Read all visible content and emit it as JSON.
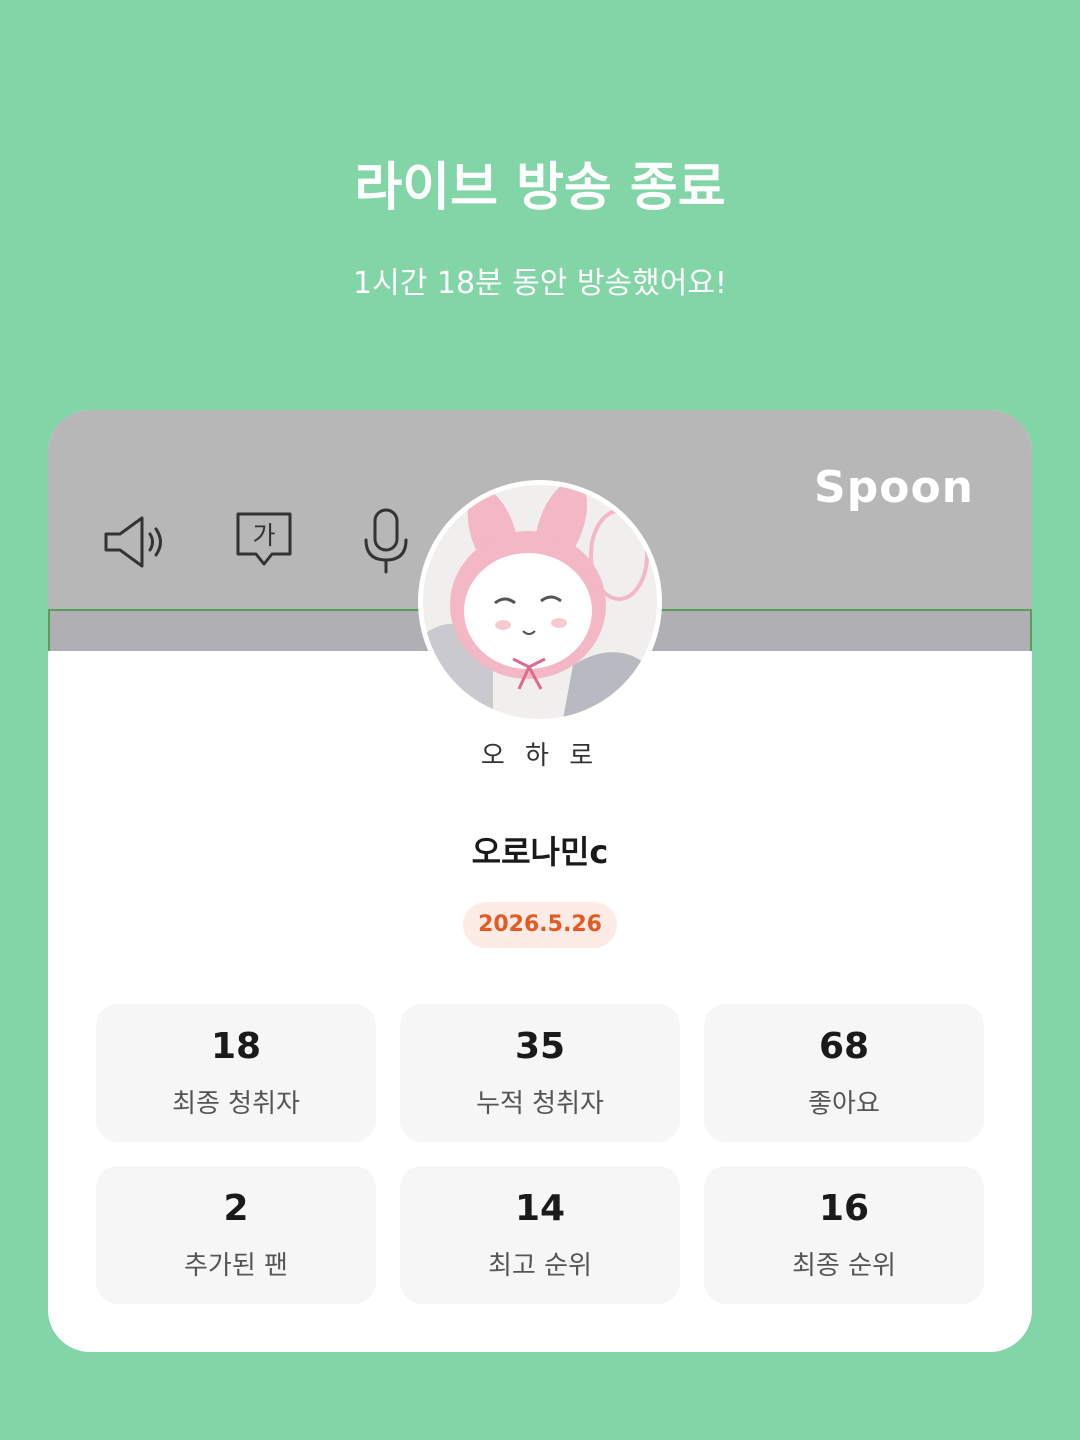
{
  "header": {
    "title": "라이브 방송 종료",
    "subtitle": "1시간 18분 동안 방송했어요!"
  },
  "card": {
    "brand": "Spoon",
    "controls": [
      "speaker-icon",
      "subtitle-icon",
      "microphone-icon"
    ],
    "subtitle_icon_text": "가",
    "avatar_caption": "오 하 로",
    "host_name": "오로나민c",
    "date": "2026.5.26",
    "stats": [
      {
        "value": "18",
        "label": "최종 청취자"
      },
      {
        "value": "35",
        "label": "누적 청취자"
      },
      {
        "value": "68",
        "label": "좋아요"
      },
      {
        "value": "2",
        "label": "추가된 팬"
      },
      {
        "value": "14",
        "label": "최고 순위"
      },
      {
        "value": "16",
        "label": "최종 순위"
      }
    ]
  },
  "colors": {
    "background": "#82d5a7",
    "banner": "#b7b7b7",
    "date_text": "#e35a22",
    "date_badge": "#fdebe5",
    "stat_tile": "#f6f6f6"
  }
}
